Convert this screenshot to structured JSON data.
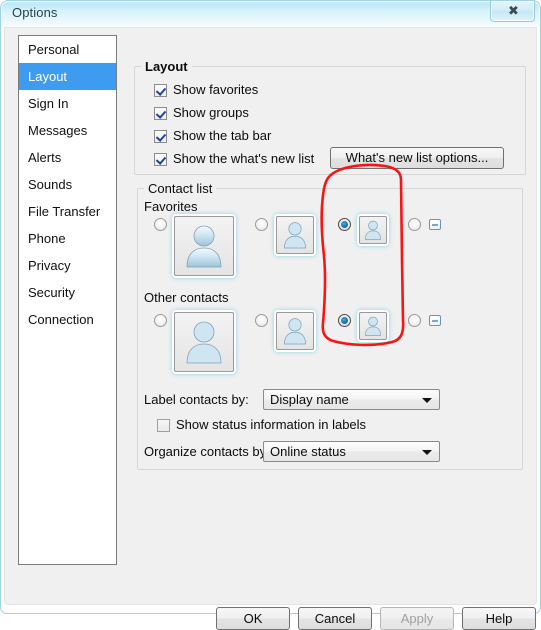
{
  "window": {
    "title": "Options",
    "close_label": "✖",
    "close_icon": "close-icon"
  },
  "sidebar": {
    "items": [
      {
        "label": "Personal",
        "selected": false
      },
      {
        "label": "Layout",
        "selected": true
      },
      {
        "label": "Sign In",
        "selected": false
      },
      {
        "label": "Messages",
        "selected": false
      },
      {
        "label": "Alerts",
        "selected": false
      },
      {
        "label": "Sounds",
        "selected": false
      },
      {
        "label": "File Transfer",
        "selected": false
      },
      {
        "label": "Phone",
        "selected": false
      },
      {
        "label": "Privacy",
        "selected": false
      },
      {
        "label": "Security",
        "selected": false
      },
      {
        "label": "Connection",
        "selected": false
      }
    ],
    "selected_color": "#3d9bf0"
  },
  "layout_group": {
    "title": "Layout",
    "checkboxes": [
      {
        "label": "Show favorites",
        "checked": true
      },
      {
        "label": "Show groups",
        "checked": true
      },
      {
        "label": "Show the tab bar",
        "checked": true
      },
      {
        "label": "Show the what's new list",
        "checked": true
      }
    ],
    "whats_new_button": "What's new list options..."
  },
  "contact_group": {
    "title": "Contact list",
    "favorites_label": "Favorites",
    "other_contacts_label": "Other contacts",
    "favorites_options": [
      {
        "name": "large-avatar",
        "selected": false
      },
      {
        "name": "medium-avatar",
        "selected": false
      },
      {
        "name": "small-avatar",
        "selected": true
      },
      {
        "name": "no-avatar",
        "selected": false
      }
    ],
    "other_options": [
      {
        "name": "large-avatar",
        "selected": false
      },
      {
        "name": "medium-avatar",
        "selected": false
      },
      {
        "name": "small-avatar",
        "selected": true
      },
      {
        "name": "no-avatar",
        "selected": false
      }
    ],
    "label_contacts_by_label": "Label contacts by:",
    "label_contacts_by_value": "Display name",
    "show_status_label": "Show status information in labels",
    "show_status_checked": false,
    "organize_by_label": "Organize contacts by:",
    "organize_by_value": "Online status"
  },
  "footer": {
    "ok": "OK",
    "cancel": "Cancel",
    "apply": "Apply",
    "apply_enabled": false,
    "help": "Help"
  },
  "annotation": {
    "type": "hand-drawn-oval",
    "color": "#fb1313",
    "description": "Red circle around the third contact-size option in both rows"
  }
}
